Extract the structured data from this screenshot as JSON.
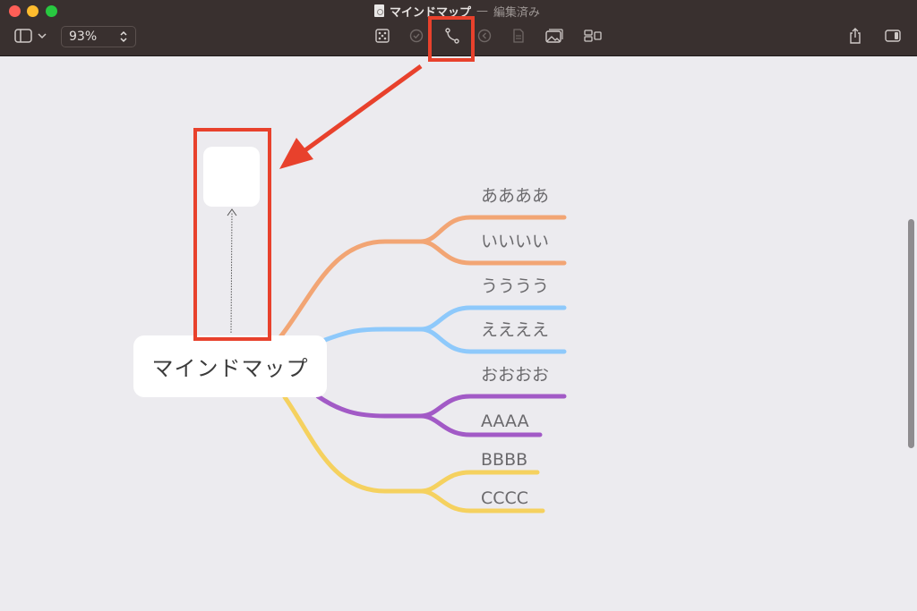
{
  "window": {
    "document_title": "マインドマップ",
    "separator": "—",
    "status": "編集済み"
  },
  "toolbar": {
    "zoom_value": "93%",
    "buttons": [
      {
        "name": "focus-icon"
      },
      {
        "name": "task-check-icon"
      },
      {
        "name": "connection-icon",
        "highlighted": true
      },
      {
        "name": "relationship-back-icon"
      },
      {
        "name": "note-icon"
      },
      {
        "name": "image-icon"
      },
      {
        "name": "layout-icon"
      }
    ],
    "share_icon": "share-icon",
    "inspector_icon": "inspector-icon"
  },
  "mindmap": {
    "central": "マインドマップ",
    "topics": [
      {
        "label": "ああああ",
        "color": "#f2a574"
      },
      {
        "label": "いいいい",
        "color": "#f2a574"
      },
      {
        "label": "うううう",
        "color": "#8ec9fb"
      },
      {
        "label": "ええええ",
        "color": "#8ec9fb"
      },
      {
        "label": "おおおお",
        "color": "#a25ac6"
      },
      {
        "label": "AAAA",
        "color": "#a25ac6"
      },
      {
        "label": "BBBB",
        "color": "#f5d15f"
      },
      {
        "label": "CCCC",
        "color": "#f5d15f"
      }
    ]
  },
  "colors": {
    "annotation": "#e8412c",
    "canvas": "#ecebef",
    "titlebar": "#39302f"
  }
}
